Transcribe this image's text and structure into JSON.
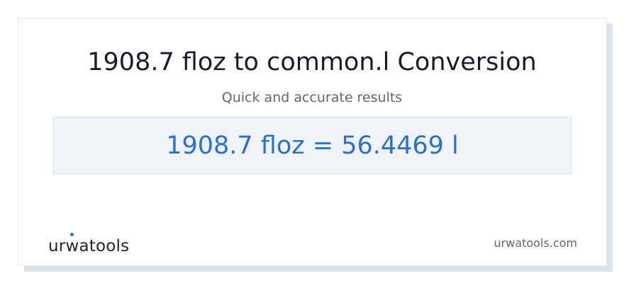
{
  "header": {
    "title": "1908.7 floz to common.l Conversion",
    "subtitle": "Quick and accurate results"
  },
  "result": {
    "text": "1908.7 floz = 56.4469 l"
  },
  "footer": {
    "logo_part1": "ur",
    "logo_w": "w",
    "logo_part2": "atools",
    "site": "urwatools.com"
  },
  "colors": {
    "accent": "#2670d6",
    "title": "#141c2d",
    "muted": "#5d6877",
    "result_bg": "#f0f4f8"
  }
}
